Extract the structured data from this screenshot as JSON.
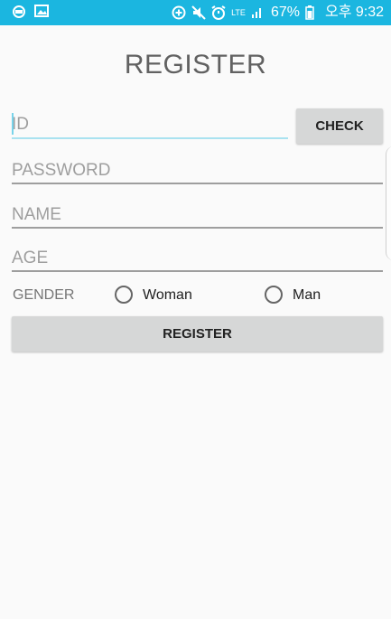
{
  "status_bar": {
    "battery": "67%",
    "time": "오후 9:32",
    "network": "LTE",
    "icons": [
      "notification-icon",
      "image-icon",
      "data-saver-icon",
      "mute-icon",
      "alarm-icon",
      "signal-icon",
      "battery-icon"
    ]
  },
  "page": {
    "title": "REGISTER"
  },
  "form": {
    "id_placeholder": "ID",
    "check_label": "CHECK",
    "password_placeholder": "PASSWORD",
    "name_placeholder": "NAME",
    "age_placeholder": "AGE",
    "gender_label": "GENDER",
    "gender_options": [
      "Woman",
      "Man"
    ],
    "register_label": "REGISTER"
  },
  "colors": {
    "status_bar": "#1bb6e0",
    "focus_line": "#a9e2f0",
    "button": "#d6d7d7",
    "background": "#fafafa"
  }
}
